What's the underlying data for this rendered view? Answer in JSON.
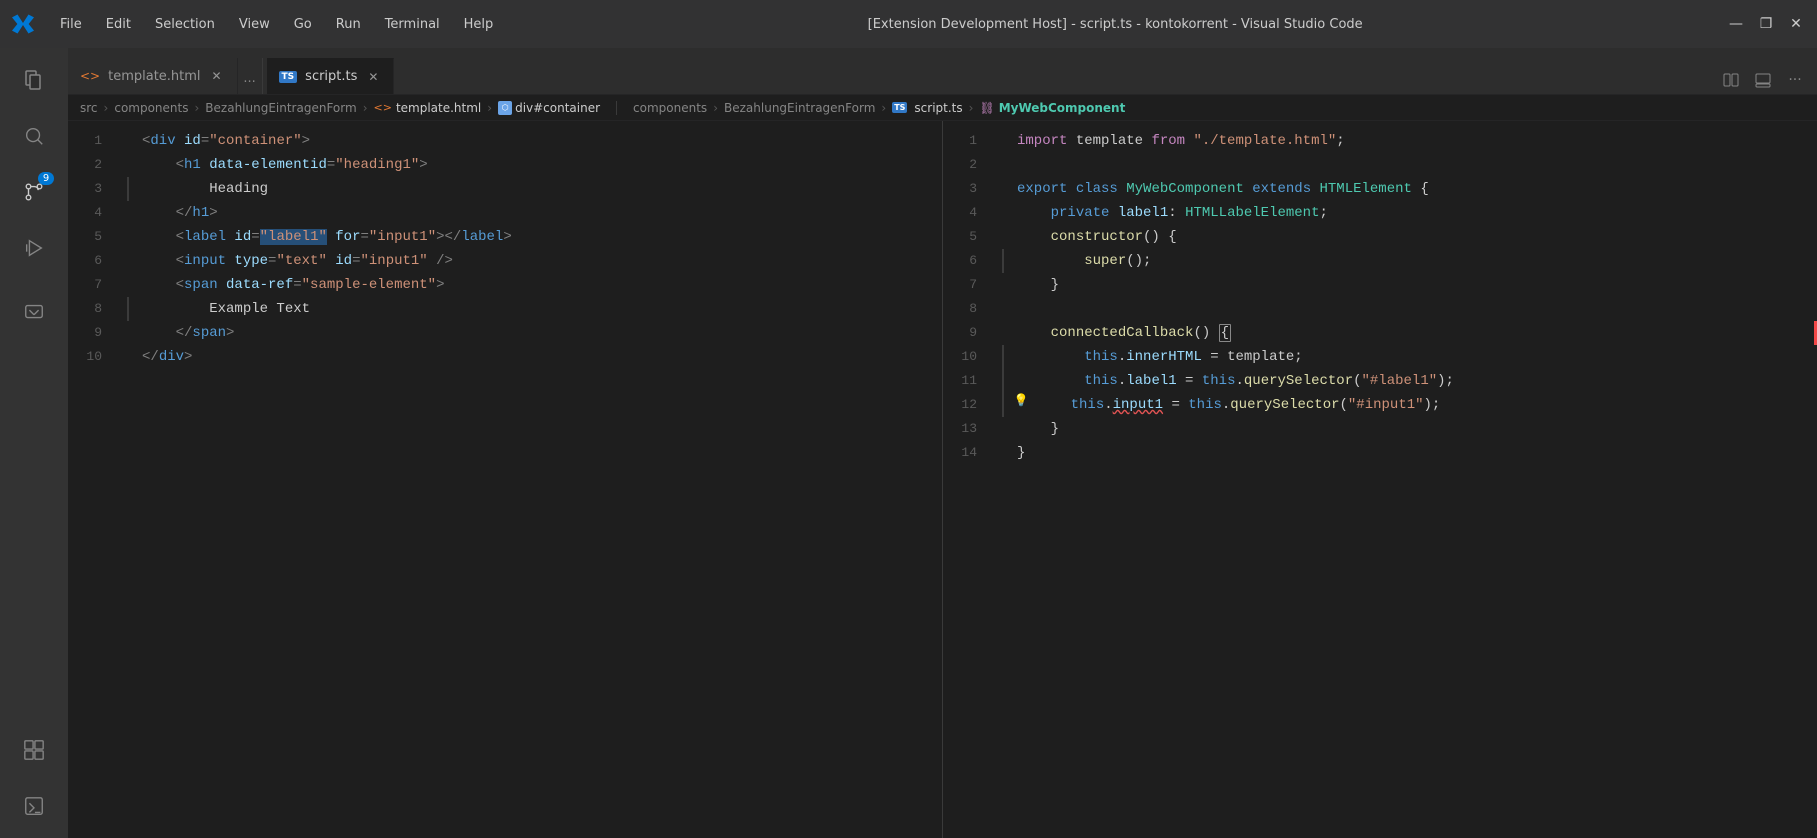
{
  "titlebar": {
    "title": "[Extension Development Host] - script.ts - kontokorrent - Visual Studio Code",
    "menu": [
      "File",
      "Edit",
      "Selection",
      "View",
      "Go",
      "Run",
      "Terminal",
      "Help"
    ],
    "controls": [
      "—",
      "❐",
      "✕"
    ]
  },
  "activity_bar": {
    "icons": [
      {
        "name": "explorer-icon",
        "symbol": "⎘",
        "active": false
      },
      {
        "name": "search-icon",
        "symbol": "🔍",
        "active": false
      },
      {
        "name": "source-control-icon",
        "symbol": "⑂",
        "active": false,
        "badge": "9"
      },
      {
        "name": "run-icon",
        "symbol": "▷",
        "active": false
      },
      {
        "name": "extensions-icon",
        "symbol": "⊞",
        "active": false
      }
    ],
    "bottom_icons": [
      {
        "name": "remote-icon",
        "symbol": "><",
        "active": false
      },
      {
        "name": "terminal-icon",
        "symbol": ">_",
        "active": false
      }
    ]
  },
  "editor_left": {
    "tab_label": "template.html",
    "tab_type": "html",
    "breadcrumb": [
      "src",
      "components",
      "BezahlungEintragenForm",
      "template.html",
      "div#container"
    ],
    "lines": [
      {
        "num": 1,
        "tokens": [
          {
            "t": "<",
            "c": "html-bracket"
          },
          {
            "t": "div",
            "c": "html-tag"
          },
          {
            "t": " id",
            "c": "html-attr"
          },
          {
            "t": "=",
            "c": "html-bracket"
          },
          {
            "t": "\"container\"",
            "c": "html-string"
          },
          {
            "t": ">",
            "c": "html-bracket"
          }
        ]
      },
      {
        "num": 2,
        "tokens": [
          {
            "t": "    ",
            "c": "html-text"
          },
          {
            "t": "<",
            "c": "html-bracket"
          },
          {
            "t": "h1",
            "c": "html-tag"
          },
          {
            "t": " data-elementid",
            "c": "html-attr"
          },
          {
            "t": "=",
            "c": "html-bracket"
          },
          {
            "t": "\"heading1\"",
            "c": "html-string"
          },
          {
            "t": ">",
            "c": "html-bracket"
          }
        ]
      },
      {
        "num": 3,
        "tokens": [
          {
            "t": "        Heading",
            "c": "html-text"
          }
        ]
      },
      {
        "num": 4,
        "tokens": [
          {
            "t": "    ",
            "c": "html-text"
          },
          {
            "t": "</",
            "c": "html-bracket"
          },
          {
            "t": "h1",
            "c": "html-tag"
          },
          {
            "t": ">",
            "c": "html-bracket"
          }
        ]
      },
      {
        "num": 5,
        "tokens": [
          {
            "t": "    ",
            "c": "html-text"
          },
          {
            "t": "<",
            "c": "html-bracket"
          },
          {
            "t": "label",
            "c": "html-tag"
          },
          {
            "t": " id",
            "c": "html-attr"
          },
          {
            "t": "=",
            "c": "html-bracket"
          },
          {
            "t": "\"label1\"",
            "c": "html-string html-selected"
          },
          {
            "t": " for",
            "c": "html-attr"
          },
          {
            "t": "=",
            "c": "html-bracket"
          },
          {
            "t": "\"input1\"",
            "c": "html-string"
          },
          {
            "t": "></",
            "c": "html-bracket"
          },
          {
            "t": "label",
            "c": "html-tag"
          },
          {
            "t": ">",
            "c": "html-bracket"
          }
        ]
      },
      {
        "num": 6,
        "tokens": [
          {
            "t": "    ",
            "c": "html-text"
          },
          {
            "t": "<",
            "c": "html-bracket"
          },
          {
            "t": "input",
            "c": "html-tag"
          },
          {
            "t": " type",
            "c": "html-attr"
          },
          {
            "t": "=",
            "c": "html-bracket"
          },
          {
            "t": "\"text\"",
            "c": "html-string"
          },
          {
            "t": " id",
            "c": "html-attr"
          },
          {
            "t": "=",
            "c": "html-bracket"
          },
          {
            "t": "\"input1\"",
            "c": "html-string"
          },
          {
            "t": " />",
            "c": "html-bracket"
          }
        ]
      },
      {
        "num": 7,
        "tokens": [
          {
            "t": "    ",
            "c": "html-text"
          },
          {
            "t": "<",
            "c": "html-bracket"
          },
          {
            "t": "span",
            "c": "html-tag"
          },
          {
            "t": " data-ref",
            "c": "html-attr"
          },
          {
            "t": "=",
            "c": "html-bracket"
          },
          {
            "t": "\"sample-element\"",
            "c": "html-string"
          },
          {
            "t": ">",
            "c": "html-bracket"
          }
        ]
      },
      {
        "num": 8,
        "tokens": [
          {
            "t": "        Example Text",
            "c": "html-text"
          }
        ]
      },
      {
        "num": 9,
        "tokens": [
          {
            "t": "    ",
            "c": "html-text"
          },
          {
            "t": "</",
            "c": "html-bracket"
          },
          {
            "t": "span",
            "c": "html-tag"
          },
          {
            "t": ">",
            "c": "html-bracket"
          }
        ]
      },
      {
        "num": 10,
        "tokens": [
          {
            "t": "</",
            "c": "html-bracket"
          },
          {
            "t": "div",
            "c": "html-tag"
          },
          {
            "t": ">",
            "c": "html-bracket"
          }
        ]
      }
    ]
  },
  "editor_right": {
    "tab_label": "script.ts",
    "tab_type": "ts",
    "breadcrumb": [
      "components",
      "BezahlungEintragenForm",
      "script.ts",
      "MyWebComponent"
    ],
    "lines": [
      {
        "num": 1,
        "tokens": [
          {
            "t": "import",
            "c": "ts-import"
          },
          {
            "t": " template ",
            "c": "ts-plain"
          },
          {
            "t": "from",
            "c": "ts-import"
          },
          {
            "t": " ",
            "c": "ts-plain"
          },
          {
            "t": "\"./template.html\"",
            "c": "ts-string"
          },
          {
            "t": ";",
            "c": "ts-plain"
          }
        ]
      },
      {
        "num": 2,
        "tokens": []
      },
      {
        "num": 3,
        "tokens": [
          {
            "t": "export",
            "c": "ts-keyword"
          },
          {
            "t": " ",
            "c": "ts-plain"
          },
          {
            "t": "class",
            "c": "ts-keyword"
          },
          {
            "t": " ",
            "c": "ts-plain"
          },
          {
            "t": "MyWebComponent",
            "c": "ts-class"
          },
          {
            "t": " ",
            "c": "ts-plain"
          },
          {
            "t": "extends",
            "c": "ts-keyword"
          },
          {
            "t": " ",
            "c": "ts-plain"
          },
          {
            "t": "HTMLElement",
            "c": "ts-type"
          },
          {
            "t": " {",
            "c": "ts-plain"
          }
        ]
      },
      {
        "num": 4,
        "tokens": [
          {
            "t": "    ",
            "c": "ts-plain"
          },
          {
            "t": "private",
            "c": "ts-keyword"
          },
          {
            "t": " label1: ",
            "c": "ts-var"
          },
          {
            "t": "HTMLLabelElement",
            "c": "ts-type"
          },
          {
            "t": ";",
            "c": "ts-plain"
          }
        ]
      },
      {
        "num": 5,
        "tokens": [
          {
            "t": "    ",
            "c": "ts-plain"
          },
          {
            "t": "constructor",
            "c": "ts-func"
          },
          {
            "t": "() {",
            "c": "ts-plain"
          }
        ]
      },
      {
        "num": 6,
        "tokens": [
          {
            "t": "        ",
            "c": "ts-plain"
          },
          {
            "t": "super",
            "c": "ts-func"
          },
          {
            "t": "();",
            "c": "ts-plain"
          }
        ]
      },
      {
        "num": 7,
        "tokens": [
          {
            "t": "    }",
            "c": "ts-plain"
          }
        ]
      },
      {
        "num": 8,
        "tokens": []
      },
      {
        "num": 9,
        "tokens": [
          {
            "t": "    ",
            "c": "ts-plain"
          },
          {
            "t": "connectedCallback",
            "c": "ts-func"
          },
          {
            "t": "() ",
            "c": "ts-plain"
          },
          {
            "t": "{",
            "c": "ts-plain bracket-highlight"
          }
        ],
        "has_bracket_highlight": true,
        "has_red_indicator": true
      },
      {
        "num": 10,
        "tokens": [
          {
            "t": "        ",
            "c": "ts-plain"
          },
          {
            "t": "this",
            "c": "ts-keyword"
          },
          {
            "t": ".",
            "c": "ts-plain"
          },
          {
            "t": "innerHTML",
            "c": "ts-var"
          },
          {
            "t": " = template;",
            "c": "ts-plain"
          }
        ]
      },
      {
        "num": 11,
        "tokens": [
          {
            "t": "        ",
            "c": "ts-plain"
          },
          {
            "t": "this",
            "c": "ts-keyword"
          },
          {
            "t": ".",
            "c": "ts-plain"
          },
          {
            "t": "label1",
            "c": "ts-var"
          },
          {
            "t": " = ",
            "c": "ts-plain"
          },
          {
            "t": "this",
            "c": "ts-keyword"
          },
          {
            "t": ".",
            "c": "ts-plain"
          },
          {
            "t": "querySelector",
            "c": "ts-func"
          },
          {
            "t": "(",
            "c": "ts-plain"
          },
          {
            "t": "\"#label1\"",
            "c": "ts-string"
          },
          {
            "t": ");",
            "c": "ts-plain"
          }
        ]
      },
      {
        "num": 12,
        "tokens": [
          {
            "t": "        ",
            "c": "ts-plain"
          },
          {
            "t": "this",
            "c": "ts-keyword"
          },
          {
            "t": ".",
            "c": "ts-plain"
          },
          {
            "t": "input1",
            "c": "ts-var squiggle"
          },
          {
            "t": " = ",
            "c": "ts-plain"
          },
          {
            "t": "this",
            "c": "ts-keyword"
          },
          {
            "t": ".",
            "c": "ts-plain"
          },
          {
            "t": "querySelector",
            "c": "ts-func"
          },
          {
            "t": "(",
            "c": "ts-plain"
          },
          {
            "t": "\"#input1\"",
            "c": "ts-string"
          },
          {
            "t": ");",
            "c": "ts-plain"
          }
        ],
        "has_lightbulb": true
      },
      {
        "num": 13,
        "tokens": [
          {
            "t": "    }",
            "c": "ts-plain"
          }
        ]
      },
      {
        "num": 14,
        "tokens": [
          {
            "t": "}",
            "c": "ts-plain"
          }
        ]
      }
    ]
  }
}
